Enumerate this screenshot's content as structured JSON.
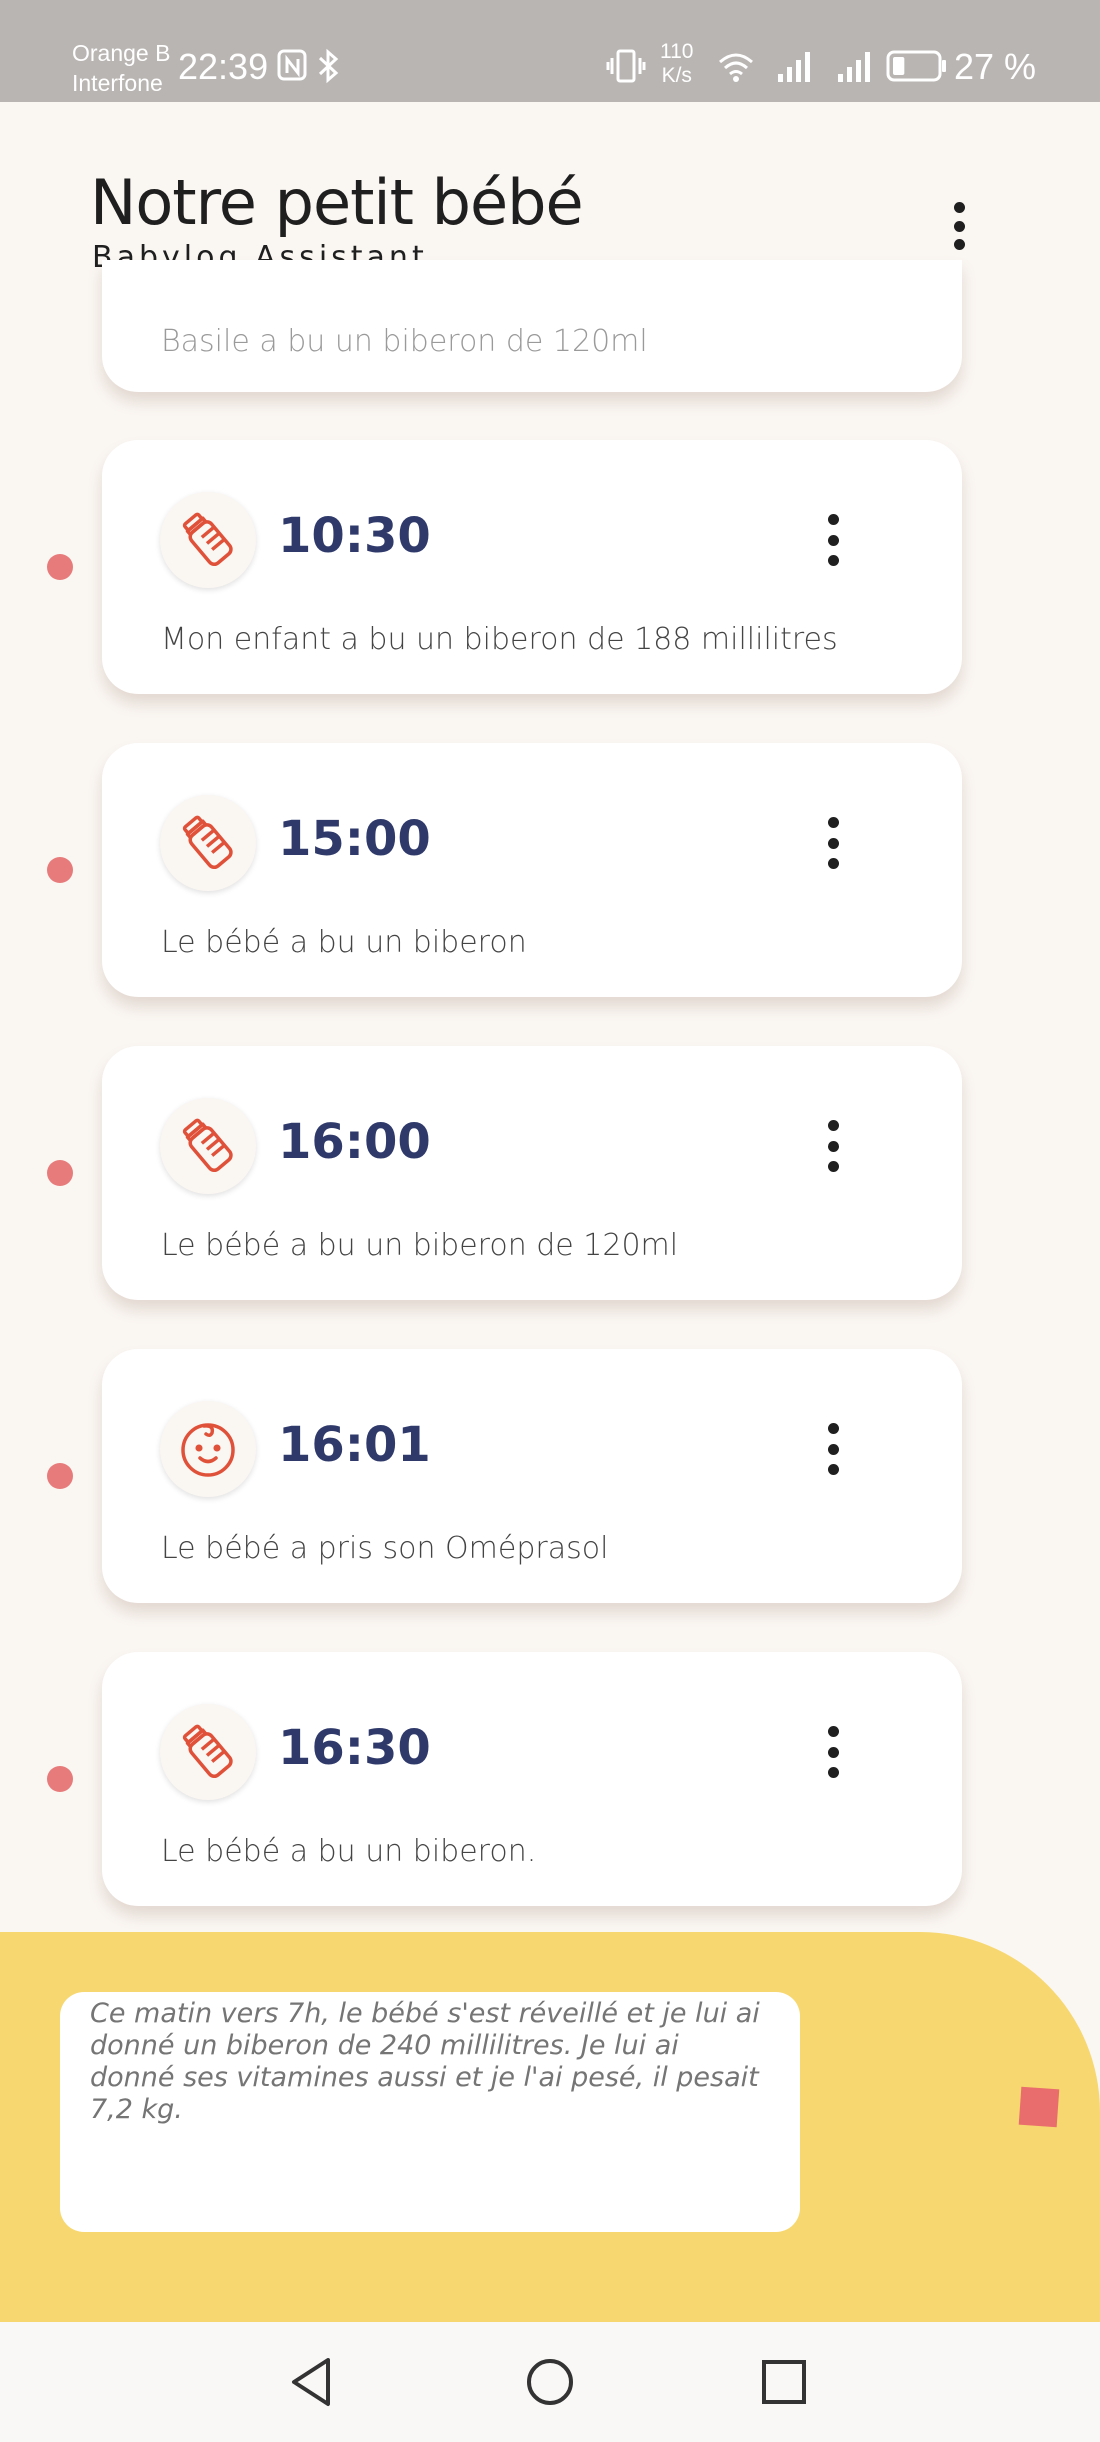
{
  "status_bar": {
    "carrier_line1": "Orange B",
    "carrier_line2": "Interfone",
    "time": "22:39",
    "speed_value": "110",
    "speed_unit": "K/s",
    "battery": "27 %",
    "battery_level": 0.27
  },
  "header": {
    "title": "Notre petit bébé",
    "subtitle": "Babylog Assistant"
  },
  "previous_entry": {
    "text": "Basile a bu un biberon de 120ml"
  },
  "entries": [
    {
      "time": "10:30",
      "icon": "baby-bottle-icon",
      "text": "Mon enfant a bu un biberon de 188 millilitres"
    },
    {
      "time": "15:00",
      "icon": "baby-bottle-icon",
      "text": "Le bébé a bu un biberon"
    },
    {
      "time": "16:00",
      "icon": "baby-bottle-icon",
      "text": "Le bébé a bu un biberon de 120ml"
    },
    {
      "time": "16:01",
      "icon": "baby-face-icon",
      "text": "Le bébé a pris son Oméprasol"
    },
    {
      "time": "16:30",
      "icon": "baby-bottle-icon",
      "text": "Le bébé a bu un biberon."
    }
  ],
  "input": {
    "placeholder": "Ce matin vers 7h, le bébé s'est réveillé et je lui ai donné un biberon de 240 millilitres. Je lui ai donné ses vitamines aussi et je l'ai pesé, il pesait 7,2 kg."
  },
  "colors": {
    "accent": "#e0513a",
    "time_text": "#2f3a6b",
    "panel": "#f7d76f",
    "timeline_dot": "#e77b7b",
    "record": "#e96d6d"
  }
}
